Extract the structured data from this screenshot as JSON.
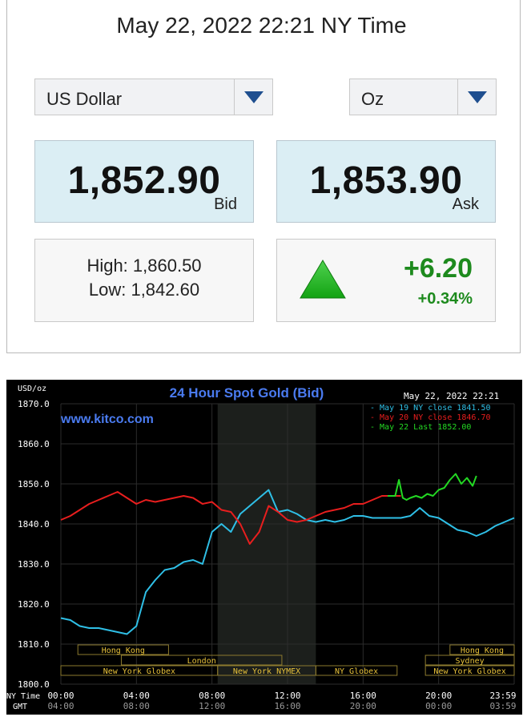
{
  "header": {
    "timestamp": "May 22, 2022 22:21 NY Time"
  },
  "currency_select": {
    "value": "US Dollar"
  },
  "unit_select": {
    "value": "Oz"
  },
  "bid": {
    "price": "1,852.90",
    "label": "Bid"
  },
  "ask": {
    "price": "1,853.90",
    "label": "Ask"
  },
  "range": {
    "high": "High: 1,860.50",
    "low": "Low: 1,842.60"
  },
  "change": {
    "value": "+6.20",
    "percent": "+0.34%",
    "direction": "up",
    "color": "#1d8a1d",
    "icon": "up-triangle-icon"
  },
  "colors": {
    "accent_blue": "#1f4f8f",
    "price_box_bg": "#dbeef4"
  },
  "chart": {
    "title": "24 Hour Spot Gold (Bid)",
    "unit_label": "USD/oz",
    "date_label": "May 22, 2022  22:21",
    "watermark": "www.kitco.com",
    "legend": [
      {
        "text": "- May 19 NY close 1841.50",
        "color": "#2fbfe6"
      },
      {
        "text": "- May 20 NY close 1846.70",
        "color": "#e81e1e"
      },
      {
        "text": "- May 22 Last 1852.00",
        "color": "#23d823"
      }
    ],
    "yticks": [
      "1870.0",
      "1860.0",
      "1850.0",
      "1840.0",
      "1830.0",
      "1820.0",
      "1810.0",
      "1800.0"
    ],
    "ny_time_label": "NY Time",
    "gmt_label": "GMT",
    "ny_ticks": [
      "00:00",
      "04:00",
      "08:00",
      "12:00",
      "16:00",
      "20:00",
      "23:59"
    ],
    "gmt_ticks": [
      "04:00",
      "08:00",
      "12:00",
      "16:00",
      "20:00",
      "00:00",
      "03:59"
    ],
    "sessions": [
      {
        "label": "Hong Kong"
      },
      {
        "label": "London"
      },
      {
        "label": "New York Globex"
      },
      {
        "label": "New York NYMEX"
      },
      {
        "label": "NY Globex"
      },
      {
        "label": "Hong Kong"
      },
      {
        "label": "Sydney"
      },
      {
        "label": "New York Globex"
      }
    ]
  },
  "chart_data": {
    "type": "line",
    "title": "24 Hour Spot Gold (Bid)",
    "ylabel": "USD/oz",
    "xlabel": "NY Time",
    "ylim": [
      1800,
      1870
    ],
    "xlim": [
      0,
      24
    ],
    "grid": true,
    "legend_position": "top-right",
    "series": [
      {
        "name": "May 19 NY close 1841.50",
        "color": "#2fbfe6",
        "x": [
          0,
          0.5,
          1,
          1.5,
          2,
          2.5,
          3,
          3.5,
          4,
          4.5,
          5,
          5.5,
          6,
          6.5,
          7,
          7.5,
          8,
          8.5,
          9,
          9.5,
          10,
          10.5,
          11,
          11.5,
          12,
          12.5,
          13,
          13.5,
          14,
          14.5,
          15,
          15.5,
          16,
          16.5,
          17,
          17.5,
          18,
          18.5,
          19,
          19.5,
          20,
          20.5,
          21,
          21.5,
          22,
          22.5,
          23,
          23.5,
          24
        ],
        "y": [
          1816.5,
          1816,
          1814.5,
          1814,
          1814,
          1813.5,
          1813,
          1812.5,
          1814.5,
          1823,
          1826,
          1828.5,
          1829,
          1830.5,
          1831,
          1830,
          1838,
          1840,
          1838,
          1842.5,
          1844.5,
          1846.5,
          1848.5,
          1843,
          1843.5,
          1842.5,
          1841,
          1840.5,
          1841,
          1840.5,
          1841,
          1842,
          1842,
          1841.5,
          1841.5,
          1841.5,
          1841.5,
          1842,
          1844,
          1842,
          1841.5,
          1840,
          1838.5,
          1838,
          1837,
          1838,
          1839.5,
          1840.5,
          1841.5
        ]
      },
      {
        "name": "May 20 NY close 1846.70",
        "color": "#e81e1e",
        "x": [
          0,
          0.5,
          1,
          1.5,
          2,
          2.5,
          3,
          3.5,
          4,
          4.5,
          5,
          5.5,
          6,
          6.5,
          7,
          7.5,
          8,
          8.5,
          9,
          9.5,
          10,
          10.5,
          11,
          11.5,
          12,
          12.5,
          13,
          13.5,
          14,
          14.5,
          15,
          15.5,
          16,
          16.5,
          17,
          17.5,
          18
        ],
        "y": [
          1841,
          1842,
          1843.5,
          1845,
          1846,
          1847,
          1848,
          1846.5,
          1845,
          1846,
          1845.5,
          1846,
          1846.5,
          1847,
          1846.5,
          1845,
          1845.5,
          1843.5,
          1843,
          1840,
          1835,
          1838,
          1844.5,
          1843,
          1841,
          1840.5,
          1841,
          1842,
          1843,
          1843.5,
          1844,
          1845,
          1845,
          1846,
          1847,
          1847,
          1847
        ]
      },
      {
        "name": "May 22 Last 1852.00",
        "color": "#23d823",
        "x": [
          17.3,
          17.5,
          17.7,
          17.9,
          18.1,
          18.3,
          18.5,
          18.8,
          19.1,
          19.4,
          19.7,
          20,
          20.3,
          20.6,
          20.9,
          21.2,
          21.5,
          21.8,
          22
        ],
        "y": [
          1847,
          1847,
          1847,
          1851,
          1846.5,
          1846,
          1846.5,
          1847,
          1846.5,
          1847.5,
          1847,
          1848.5,
          1849,
          1851,
          1852.5,
          1850,
          1851.5,
          1849.5,
          1852
        ]
      }
    ]
  }
}
